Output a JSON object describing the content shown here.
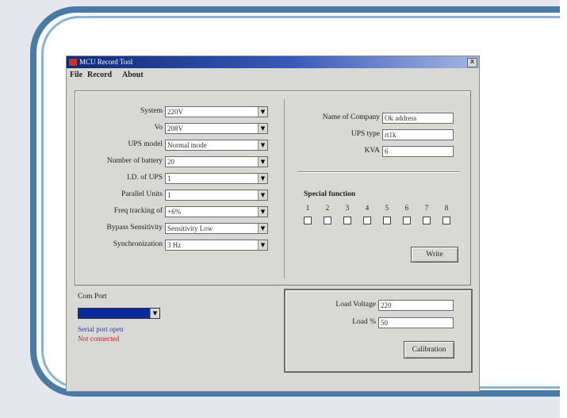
{
  "window": {
    "title": "MCU Record Tool",
    "close_glyph": "x",
    "menu": [
      "File",
      "Record",
      "About"
    ]
  },
  "settings": [
    {
      "label": "System",
      "value": "220V"
    },
    {
      "label": "Vo",
      "value": "208V"
    },
    {
      "label": "UPS model",
      "value": "Normal mode"
    },
    {
      "label": "Number of battery",
      "value": "20"
    },
    {
      "label": "I.D. of UPS",
      "value": "1"
    },
    {
      "label": "Parallel Units",
      "value": "1"
    },
    {
      "label": "Freq tracking of",
      "value": "+6%"
    },
    {
      "label": "Bypass Sensitivity",
      "value": "Sensitivity Low"
    },
    {
      "label": "Synchronization",
      "value": "3 Hz"
    }
  ],
  "info": [
    {
      "label": "Name of Company",
      "value": "Ok address"
    },
    {
      "label": "UPS type",
      "value": "rt1k"
    },
    {
      "label": "KVA",
      "value": "6"
    }
  ],
  "special": {
    "title": "Special function",
    "numbers": [
      "1",
      "2",
      "3",
      "4",
      "5",
      "6",
      "7",
      "8"
    ],
    "write_label": "Write"
  },
  "com": {
    "label": "Com Port",
    "value": "",
    "status1": "Serial port open",
    "status2": "Not connected",
    "status1_color": "#2a3fb0",
    "status2_color": "#cc2222"
  },
  "calibration": {
    "load_voltage_label": "Load Voltage",
    "load_voltage_value": "220",
    "load_pct_label": "Load %",
    "load_pct_value": "50",
    "button_label": "Calibration"
  },
  "icons": {
    "dropdown": "▼",
    "app": "app-icon"
  }
}
